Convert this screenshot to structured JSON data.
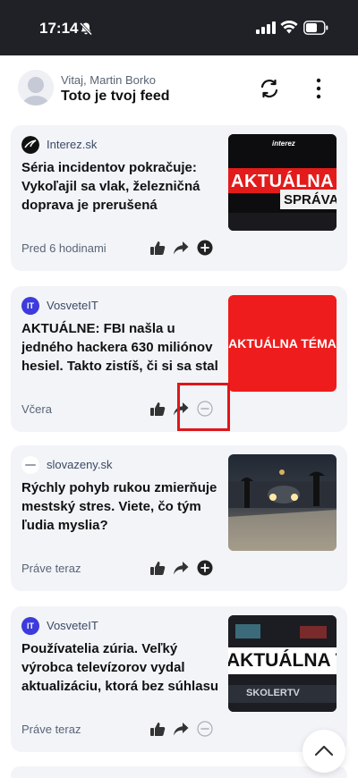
{
  "status_bar": {
    "time": "17:14"
  },
  "header": {
    "greeting": "Vitaj, Martin Borko",
    "title": "Toto je tvoj feed"
  },
  "cards": [
    {
      "source": "Interez.sk",
      "headline": "Séria incidentov pokračuje: Vykoľajil sa vlak, železničná doprava je prerušená",
      "time": "Pred 6 hodinami",
      "thumb_text": [
        "interez",
        "AKTUÁLNA",
        "SPRÁVA"
      ],
      "action": "add"
    },
    {
      "source": "VosveteIT",
      "source_logo_text": "IT",
      "headline": "AKTUÁLNE: FBI našla u jedného hackera 630 miliónov hesiel. Takto zistíš, či si sa stal obeťou hacker…",
      "time": "Včera",
      "thumb_text": [
        "AKTUÁLNA TÉMA"
      ],
      "action": "remove"
    },
    {
      "source": "slovazeny.sk",
      "headline": "Rýchly pohyb rukou zmierňuje mestský stres. Viete, čo tým ľudia myslia?",
      "time": "Práve teraz",
      "action": "add"
    },
    {
      "source": "VosveteIT",
      "source_logo_text": "IT",
      "headline": "Používatelia zúria. Veľký výrobca televízorov vydal aktualizáciu, ktorá bez súhlasu inštaluje apliká…",
      "time": "Práve teraz",
      "thumb_text": [
        "AKTUÁLNA TÉM",
        "SKOLERTV"
      ],
      "action": "remove"
    }
  ],
  "colors": {
    "accent_red": "#e0161a",
    "card_bg": "#f2f4f8",
    "it_blue": "#3d3bdc"
  }
}
